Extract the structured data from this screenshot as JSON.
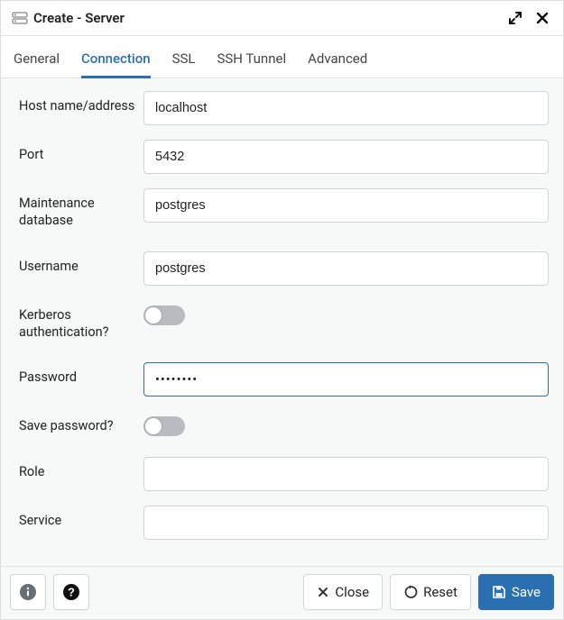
{
  "window": {
    "title": "Create - Server"
  },
  "tabs": {
    "general": "General",
    "connection": "Connection",
    "ssl": "SSL",
    "ssh": "SSH Tunnel",
    "advanced": "Advanced"
  },
  "labels": {
    "host": "Host name/address",
    "port": "Port",
    "maintdb": "Maintenance database",
    "username": "Username",
    "kerberos": "Kerberos authentication?",
    "password": "Password",
    "savepw": "Save password?",
    "role": "Role",
    "service": "Service"
  },
  "values": {
    "host": "localhost",
    "port": "5432",
    "maintdb": "postgres",
    "username": "postgres",
    "password": "••••••••",
    "role": "",
    "service": ""
  },
  "toggles": {
    "kerberos": false,
    "savepw": false
  },
  "buttons": {
    "close": "Close",
    "reset": "Reset",
    "save": "Save"
  }
}
